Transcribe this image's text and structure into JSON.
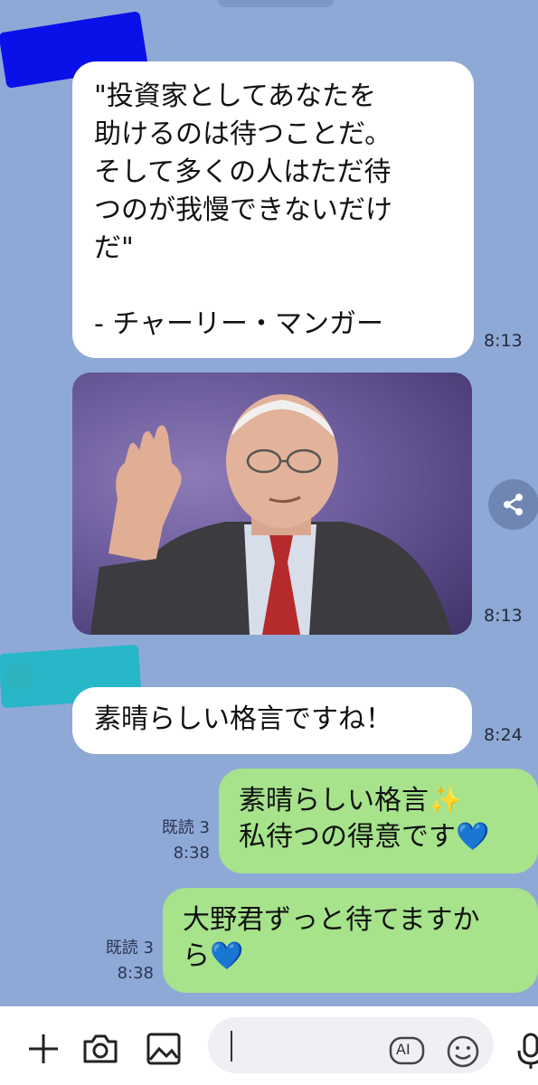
{
  "messages": {
    "quote": {
      "text": "\"投資家としてあなたを\n助けるのは待つことだ。\nそして多くの人はただ待\nつのが我慢できないだけ\nだ\"\n\n- チャーリー・マンガー",
      "time": "8:13"
    },
    "photo": {
      "time": "8:13"
    },
    "reply1": {
      "text": "素晴らしい格言ですね！",
      "time": "8:24"
    },
    "sent1": {
      "text": "素晴らしい格言✨\n私待つの得意です💙",
      "read": "既読 3",
      "time": "8:38"
    },
    "sent2": {
      "text": "大野君ずっと待てますか\nら💙",
      "read": "既読 3",
      "time": "8:38"
    }
  },
  "input": {
    "ai_label": "AI"
  },
  "colors": {
    "background": "#8fa9d6",
    "sent_bubble": "#a6e38b",
    "received_bubble": "#ffffff",
    "redaction": "#0a10e8"
  },
  "icons": [
    "share-icon",
    "plus-icon",
    "camera-icon",
    "image-icon",
    "ai-icon",
    "emoji-icon",
    "mic-icon"
  ]
}
